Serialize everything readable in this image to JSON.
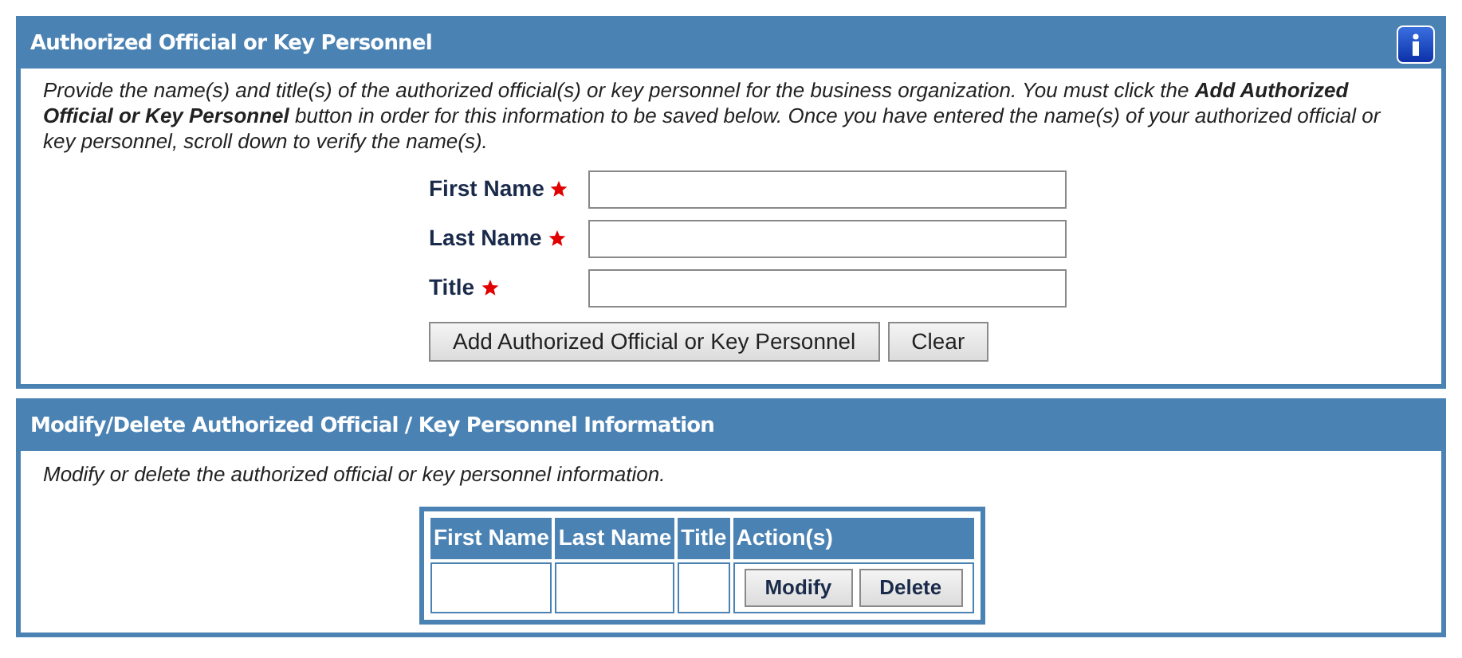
{
  "add_section": {
    "title": "Authorized Official or Key Personnel",
    "instructions": "Provide the name(s) and title(s) of the authorized official(s) or key personnel for the business organization. You must click the **Add Authorized Official or Key Personnel** button in order for this information to be saved below. Once you have entered the name(s) of your authorized official or key personnel, scroll down to verify the name(s).",
    "fields": [
      {
        "label": "First Name",
        "required": true
      },
      {
        "label": "Last Name",
        "required": true
      },
      {
        "label": "Title",
        "required": true
      }
    ],
    "buttons": [
      "Add Authorized Official or Key Personnel",
      "Clear"
    ]
  },
  "modify_section": {
    "title": "Modify/Delete Authorized Official / Key Personnel Information",
    "instructions": "Modify or delete the authorized official or key personnel information.",
    "table": {
      "columns": [
        "First Name",
        "Last Name",
        "Title",
        "Action(s)"
      ],
      "rows": [
        {
          "actions": [
            "Modify",
            "Delete"
          ]
        }
      ]
    }
  }
}
